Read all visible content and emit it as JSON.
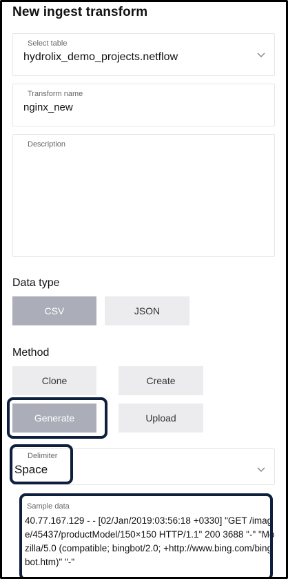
{
  "page": {
    "title": "New ingest transform"
  },
  "select_table": {
    "label": "Select table",
    "value": "hydrolix_demo_projects.netflow",
    "icon": "chevron-down-icon"
  },
  "transform_name": {
    "label": "Transform name",
    "value": "nginx_new"
  },
  "description": {
    "label": "Description",
    "value": ""
  },
  "data_type": {
    "heading": "Data type",
    "options": [
      {
        "label": "CSV",
        "selected": true
      },
      {
        "label": "JSON",
        "selected": false
      }
    ]
  },
  "method": {
    "heading": "Method",
    "options": [
      {
        "label": "Clone",
        "selected": false
      },
      {
        "label": "Create",
        "selected": false
      },
      {
        "label": "Generate",
        "selected": true
      },
      {
        "label": "Upload",
        "selected": false
      }
    ]
  },
  "delimiter": {
    "label": "Delimiter",
    "value": "Space",
    "icon": "chevron-down-icon"
  },
  "sample_data": {
    "label": "Sample data",
    "value": "40.77.167.129 - - [02/Jan/2019:03:56:18 +0330] \"GET /image/45437/productModel/150×150 HTTP/1.1\" 200 3688 \"-\" \"Mozilla/5.0 (compatible; bingbot/2.0; +http://www.bing.com/bingbot.htm)\" \"-\""
  },
  "colors": {
    "selected_button": "#abadb8",
    "button": "#ececef",
    "highlight": "#0d1f3c"
  }
}
